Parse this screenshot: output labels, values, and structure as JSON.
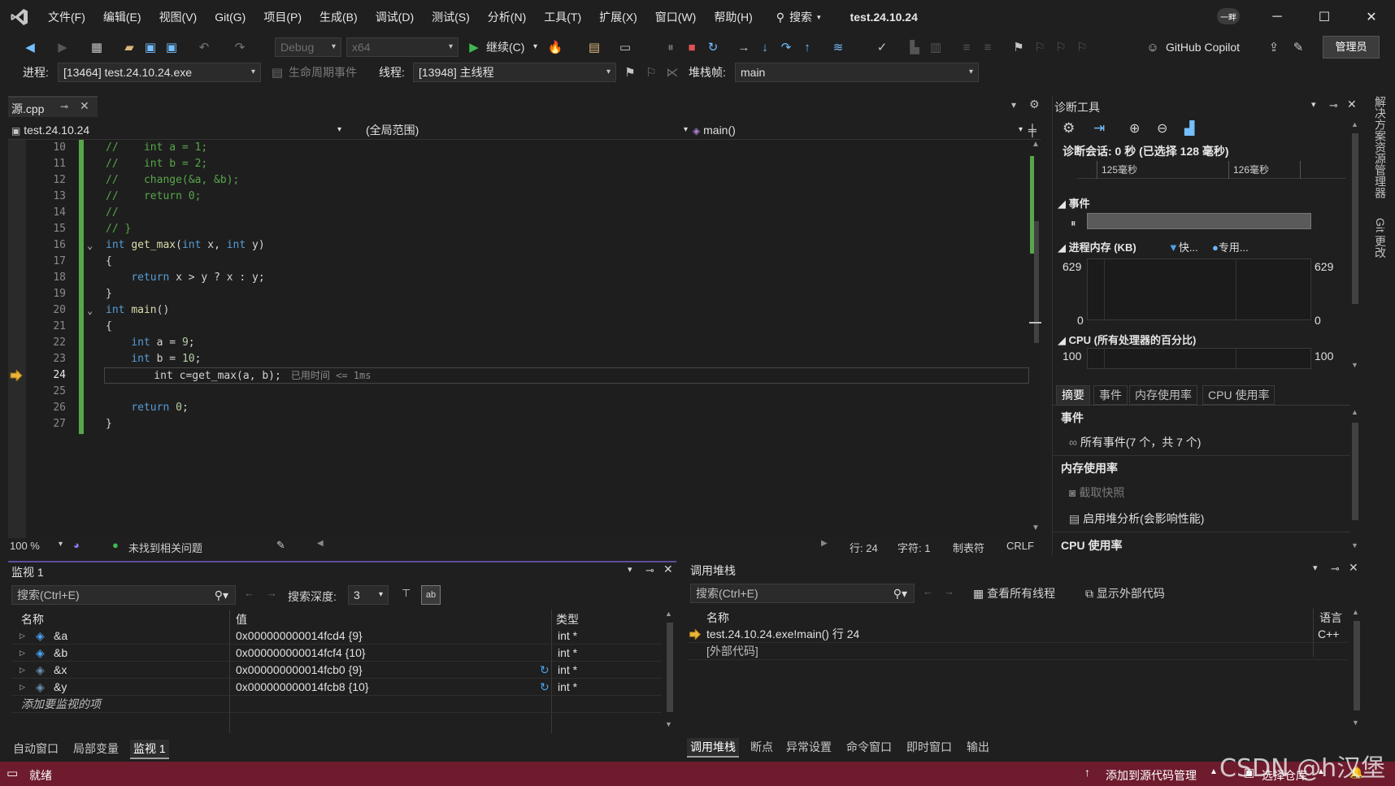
{
  "menu": {
    "items": [
      "文件(F)",
      "编辑(E)",
      "视图(V)",
      "Git(G)",
      "项目(P)",
      "生成(B)",
      "调试(D)",
      "测试(S)",
      "分析(N)",
      "工具(T)",
      "扩展(X)",
      "窗口(W)",
      "帮助(H)"
    ],
    "search_label": "搜索",
    "project_title": "test.24.10.24",
    "badge": "一畔"
  },
  "toolbar": {
    "config": "Debug",
    "platform": "x64",
    "continue_label": "继续(C)",
    "copilot_label": "GitHub Copilot",
    "admin_label": "管理员",
    "process_label": "进程:",
    "process_value": "[13464] test.24.10.24.exe",
    "lifecycle_label": "生命周期事件",
    "thread_label": "线程:",
    "thread_value": "[13948] 主线程",
    "stackframe_label": "堆栈帧:",
    "stackframe_value": "main"
  },
  "editor": {
    "tab_label": "源.cpp",
    "nav_project": "test.24.10.24",
    "nav_scope": "(全局范围)",
    "nav_function": "main()",
    "lines": [
      {
        "n": "10",
        "code": "//    int a = 1;"
      },
      {
        "n": "11",
        "code": "//    int b = 2;"
      },
      {
        "n": "12",
        "code": "//    change(&a, &b);"
      },
      {
        "n": "13",
        "code": "//    return 0;"
      },
      {
        "n": "14",
        "code": "//"
      },
      {
        "n": "15",
        "code": "// }"
      },
      {
        "n": "16",
        "code": "int get_max(int x, int y)"
      },
      {
        "n": "17",
        "code": "{"
      },
      {
        "n": "18",
        "code": "    return x > y ? x : y;"
      },
      {
        "n": "19",
        "code": "}"
      },
      {
        "n": "20",
        "code": "int main()"
      },
      {
        "n": "21",
        "code": "{"
      },
      {
        "n": "22",
        "code": "    int a = 9;"
      },
      {
        "n": "23",
        "code": "    int b = 10;"
      },
      {
        "n": "24",
        "code": "    int c=get_max(a, b);"
      },
      {
        "n": "25",
        "code": ""
      },
      {
        "n": "26",
        "code": "    return 0;"
      },
      {
        "n": "27",
        "code": "}"
      }
    ],
    "elapsed_hint": "已用时间 <= 1ms",
    "status": {
      "zoom": "100 %",
      "issues": "未找到相关问题",
      "line": "行: 24",
      "char": "字符: 1",
      "tabs": "制表符",
      "eol": "CRLF"
    }
  },
  "diagnostics": {
    "title": "诊断工具",
    "session": "诊断会话: 0 秒 (已选择 128 毫秒)",
    "ticks": [
      "125毫秒",
      "126毫秒"
    ],
    "events_label": "事件",
    "memory_label": "进程内存 (KB)",
    "memory_legend_fast": "快...",
    "memory_legend_private": "专用...",
    "memory_max": "629",
    "memory_min": "0",
    "cpu_label": "CPU (所有处理器的百分比)",
    "cpu_max": "100",
    "tabs": [
      "摘要",
      "事件",
      "内存使用率",
      "CPU 使用率"
    ],
    "summary": {
      "events_head": "事件",
      "all_events": "所有事件(7 个，共 7 个)",
      "memory_head": "内存使用率",
      "snapshot": "截取快照",
      "heap_profile": "启用堆分析(会影响性能)",
      "cpu_head": "CPU 使用率"
    }
  },
  "side_tabs": [
    "解决方案资源管理器",
    "Git 更改"
  ],
  "watch": {
    "title": "监视 1",
    "search_placeholder": "搜索(Ctrl+E)",
    "depth_label": "搜索深度:",
    "depth_value": "3",
    "columns": [
      "名称",
      "值",
      "类型"
    ],
    "rows": [
      {
        "name": "&a",
        "value": "0x000000000014fcd4 {9}",
        "type": "int *"
      },
      {
        "name": "&b",
        "value": "0x000000000014fcf4 {10}",
        "type": "int *"
      },
      {
        "name": "&x",
        "value": "0x000000000014fcb0 {9}",
        "type": "int *"
      },
      {
        "name": "&y",
        "value": "0x000000000014fcb8 {10}",
        "type": "int *"
      }
    ],
    "add_placeholder": "添加要监视的项",
    "tabs": [
      "自动窗口",
      "局部变量",
      "监视 1"
    ]
  },
  "callstack": {
    "title": "调用堆栈",
    "search_placeholder": "搜索(Ctrl+E)",
    "view_threads": "查看所有线程",
    "show_external": "显示外部代码",
    "columns": [
      "名称",
      "语言"
    ],
    "rows": [
      {
        "name": "test.24.10.24.exe!main() 行 24",
        "lang": "C++"
      },
      {
        "name": "[外部代码]",
        "lang": ""
      }
    ],
    "tabs": [
      "调用堆栈",
      "断点",
      "异常设置",
      "命令窗口",
      "即时窗口",
      "输出"
    ]
  },
  "statusbar": {
    "ready": "就绪",
    "add_source": "添加到源代码管理",
    "select_repo": "选择仓库"
  },
  "watermark": "CSDN @h汉堡",
  "colors": {
    "status_bar": "#6e1b2e",
    "accent_green": "#57a64a",
    "keyword": "#569cd6"
  }
}
